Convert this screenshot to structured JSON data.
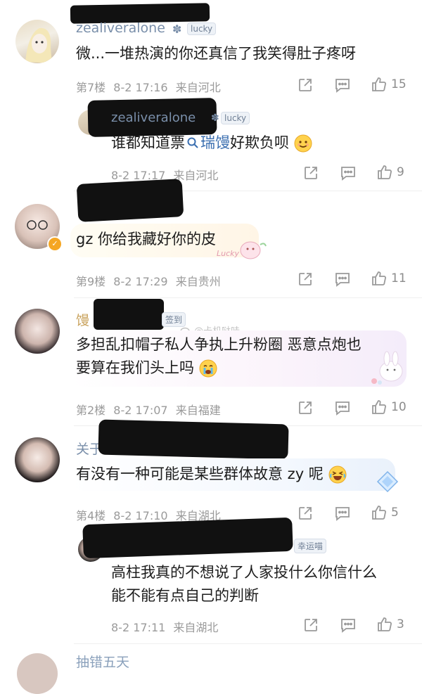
{
  "top_clipped": "",
  "comments": [
    {
      "id": "c1",
      "username": "zealiveralone",
      "badge": "lucky",
      "text": "微...一堆热演的你还真信了我笑得肚子疼呀",
      "floor": "第7楼",
      "date": "8-2 17:16",
      "location": "来自河北",
      "likes": "15",
      "reply": {
        "username": "zealiveralone",
        "badge": "lucky",
        "text_before": "谁都知道票",
        "search_term": "瑞馒",
        "text_after": "好欺负呗",
        "date": "8-2 17:17",
        "location": "来自河北",
        "likes": "9"
      }
    },
    {
      "id": "c2",
      "username": "",
      "text": "gz 你给我藏好你的皮",
      "floor": "第9楼",
      "date": "8-2 17:29",
      "location": "来自贵州",
      "likes": "11",
      "sticker": "Lucky"
    },
    {
      "id": "c3",
      "username": "馒",
      "badge": "签到",
      "watermark": "@卡机哒哇",
      "text_line1": "多担乱扣帽子私人争执上升粉圈 恶意点炮也",
      "text_line2": "要算在我们头上吗",
      "floor": "第2楼",
      "date": "8-2 17:07",
      "location": "来自福建",
      "likes": "10"
    },
    {
      "id": "c4",
      "username": "关于",
      "text": "有没有一种可能是某些群体故意 zy 呢",
      "floor": "第4楼",
      "date": "8-2 17:10",
      "location": "来自湖北",
      "likes": "5",
      "reply": {
        "username": "",
        "badge": "幸运喵",
        "text_line1": "高柱我真的不想说了人家投什么你信什么",
        "text_line2": "能不能有点自己的判断",
        "date": "8-2 17:11",
        "location": "来自湖北",
        "likes": "3"
      }
    }
  ],
  "bottom_clipped_name": "抽错五天"
}
